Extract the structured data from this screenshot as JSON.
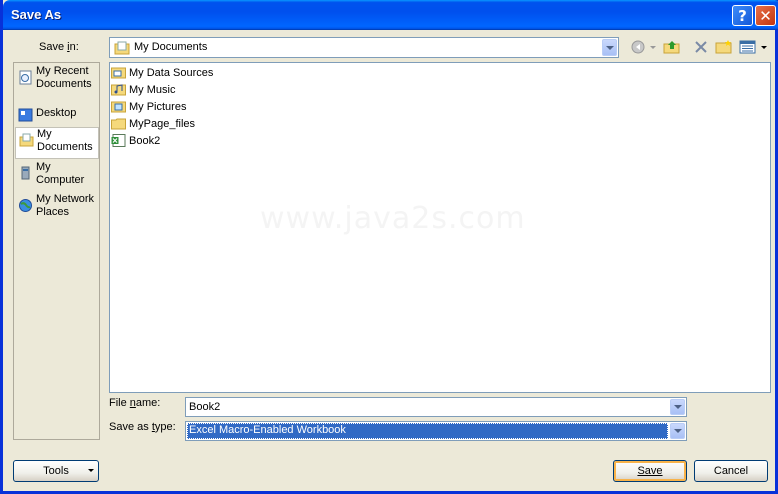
{
  "window": {
    "title": "Save As"
  },
  "save_in": {
    "label_pre": "Save ",
    "label_u": "i",
    "label_post": "n:",
    "value": "My Documents"
  },
  "places": [
    {
      "label": "My Recent Documents",
      "icon": "recent-documents-icon"
    },
    {
      "label": "Desktop",
      "icon": "desktop-icon"
    },
    {
      "label": "My Documents",
      "icon": "my-documents-icon",
      "selected": true
    },
    {
      "label": "My Computer",
      "icon": "my-computer-icon"
    },
    {
      "label": "My Network Places",
      "icon": "network-places-icon"
    }
  ],
  "files": [
    {
      "name": "My Data Sources",
      "icon": "data-sources-folder-icon"
    },
    {
      "name": "My Music",
      "icon": "music-folder-icon"
    },
    {
      "name": "My Pictures",
      "icon": "pictures-folder-icon"
    },
    {
      "name": "MyPage_files",
      "icon": "folder-icon"
    },
    {
      "name": "Book2",
      "icon": "excel-workbook-icon"
    }
  ],
  "watermark": "www.java2s.com",
  "file_name": {
    "label_pre": "File ",
    "label_u": "n",
    "label_post": "ame:",
    "value": "Book2"
  },
  "save_as_type": {
    "label_pre": "Save as ",
    "label_u": "t",
    "label_post": "ype:",
    "value": "Excel Macro-Enabled Workbook"
  },
  "buttons": {
    "tools": "Tools",
    "save": "Save",
    "cancel": "Cancel"
  },
  "colors": {
    "titlebar": "#0053ee",
    "selection": "#316ac5",
    "dialog_bg": "#ece9d8"
  }
}
